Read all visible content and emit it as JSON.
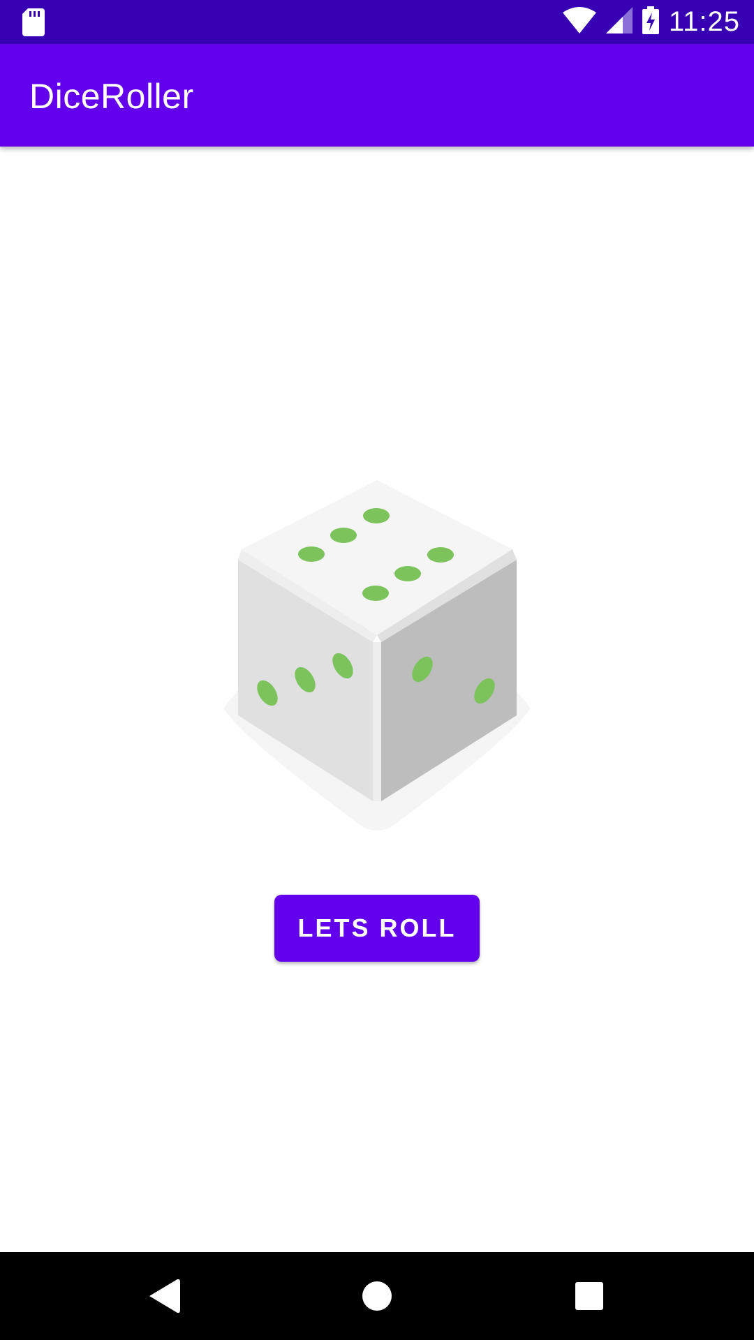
{
  "status_bar": {
    "time": "11:25",
    "icons": [
      "sd-card-icon",
      "wifi-icon",
      "signal-icon",
      "battery-charging-icon"
    ]
  },
  "app_bar": {
    "title": "DiceRoller"
  },
  "dice": {
    "face_value": 6,
    "pip_color": "#7cc35b"
  },
  "roll_button": {
    "label": "LETS ROLL"
  },
  "nav_bar": {
    "icons": [
      "back-icon",
      "home-icon",
      "recents-icon"
    ]
  },
  "colors": {
    "status_bar": "#3700b3",
    "primary": "#6200ee",
    "nav_bar": "#000000"
  }
}
